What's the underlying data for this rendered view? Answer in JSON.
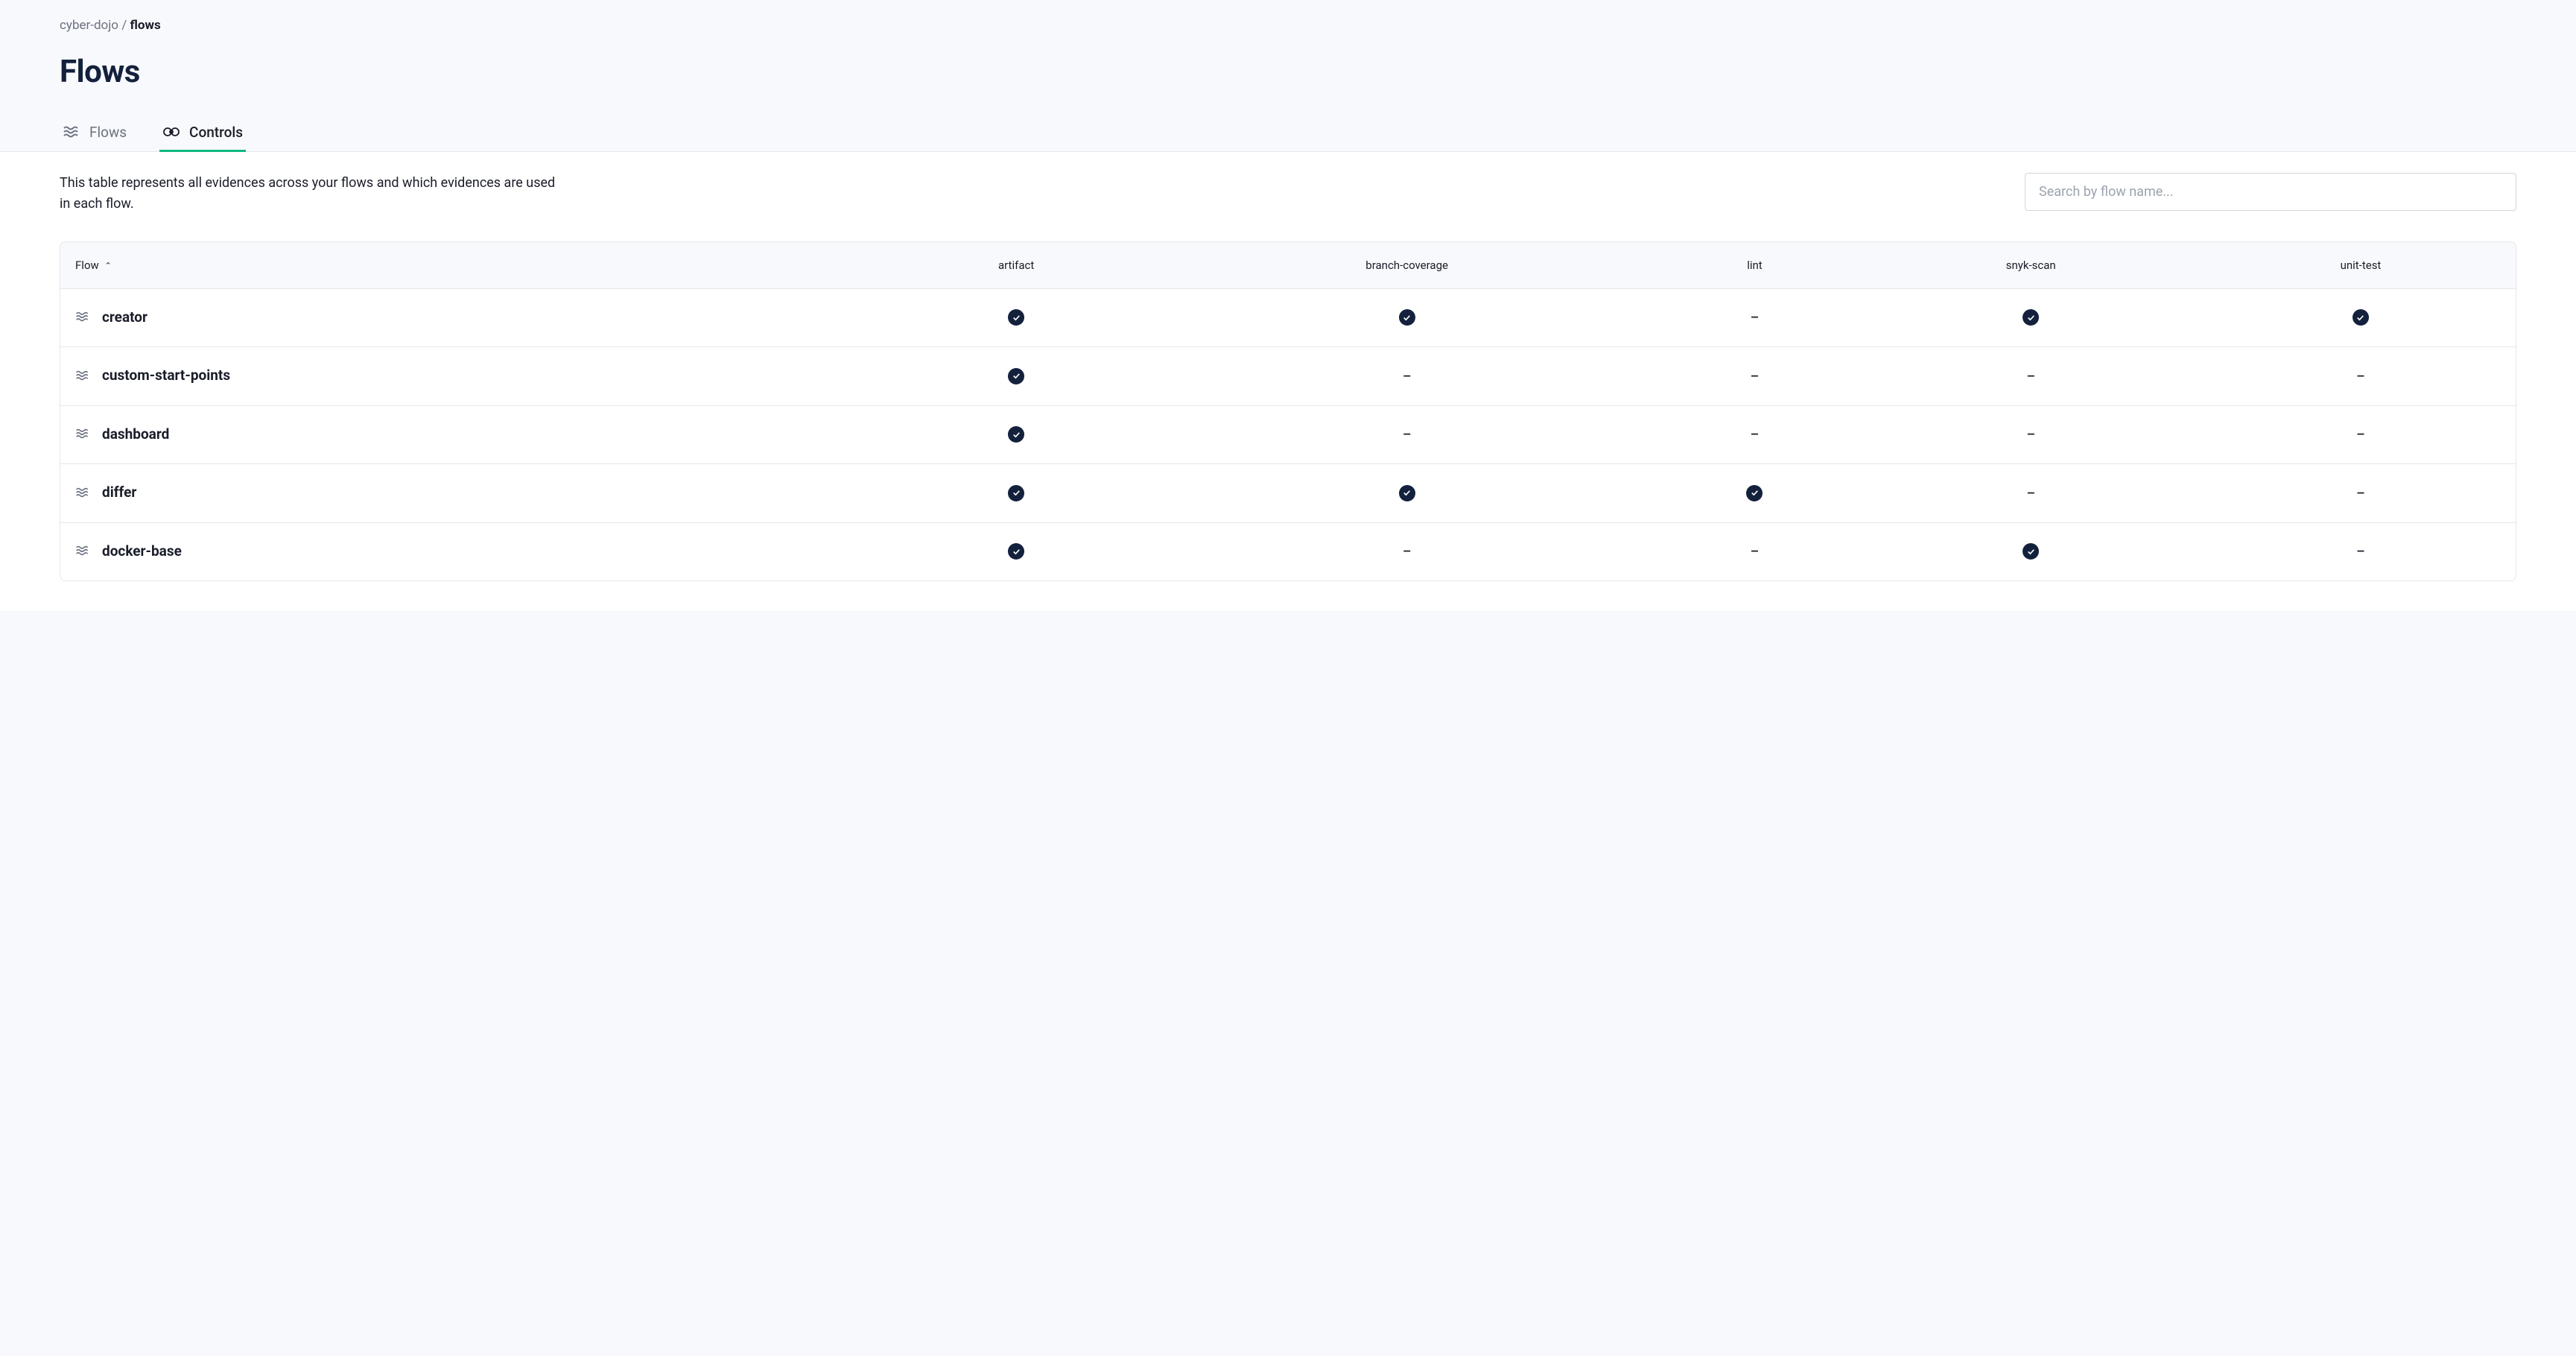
{
  "breadcrumb": {
    "parent": "cyber-dojo",
    "separator": "/",
    "current": "flows"
  },
  "page_title": "Flows",
  "tabs": {
    "flows": {
      "label": "Flows"
    },
    "controls": {
      "label": "Controls"
    }
  },
  "description": "This table represents all evidences across your flows and which evidences are used in each flow.",
  "search": {
    "placeholder": "Search by flow name..."
  },
  "table": {
    "sort_column_label": "Flow",
    "columns": [
      "artifact",
      "branch-coverage",
      "lint",
      "snyk-scan",
      "unit-test"
    ],
    "rows": [
      {
        "name": "creator",
        "values": [
          true,
          true,
          false,
          true,
          true
        ]
      },
      {
        "name": "custom-start-points",
        "values": [
          true,
          false,
          false,
          false,
          false
        ]
      },
      {
        "name": "dashboard",
        "values": [
          true,
          false,
          false,
          false,
          false
        ]
      },
      {
        "name": "differ",
        "values": [
          true,
          true,
          true,
          false,
          false
        ]
      },
      {
        "name": "docker-base",
        "values": [
          true,
          false,
          false,
          true,
          false
        ]
      }
    ]
  }
}
